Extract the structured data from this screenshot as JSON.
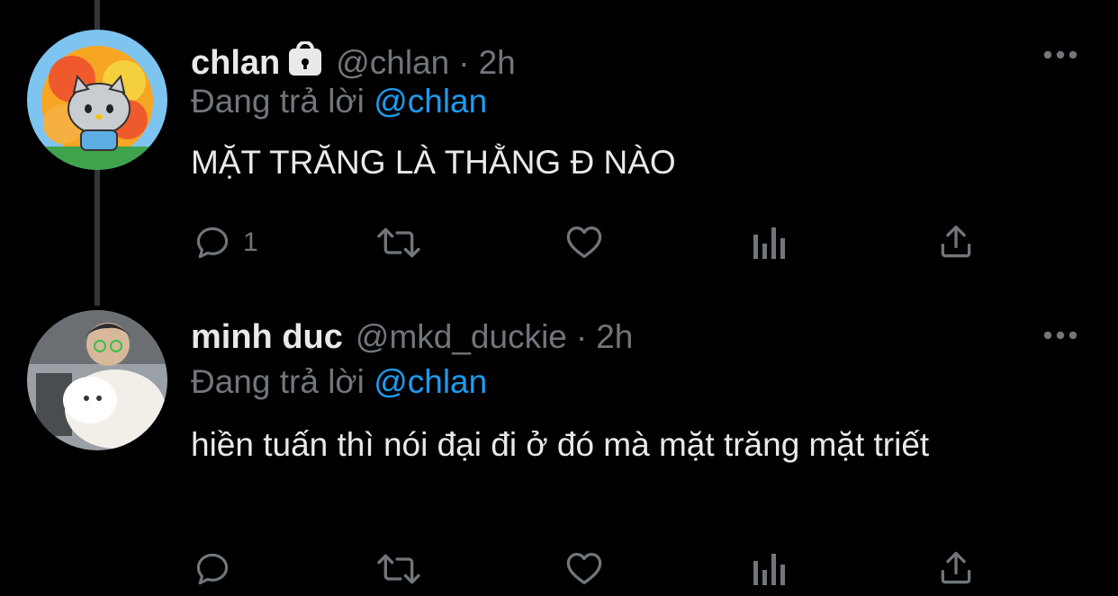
{
  "tweets": [
    {
      "display_name": "chlan",
      "protected": true,
      "handle": "@chlan",
      "separator": "·",
      "time": "2h",
      "reply_prefix": "Đang trả lời",
      "reply_to": "@chlan",
      "text": "MẶT TRĂNG LÀ THẰNG Đ NÀO",
      "reply_count": "1"
    },
    {
      "display_name": "minh duc",
      "protected": false,
      "handle": "@mkd_duckie",
      "separator": "·",
      "time": "2h",
      "reply_prefix": "Đang trả lời",
      "reply_to": "@chlan",
      "text": "hiền tuấn thì nói đại đi ở đó mà mặt trăng mặt triết",
      "reply_count": ""
    }
  ],
  "icons": {
    "protected": "lock-icon",
    "more": "more-horizontal-icon",
    "reply": "reply-icon",
    "retweet": "retweet-icon",
    "like": "heart-icon",
    "analytics": "analytics-icon",
    "share": "share-icon"
  },
  "colors": {
    "background": "#000000",
    "primary_text": "#e7e9ea",
    "secondary_text": "#71767b",
    "accent": "#1d9bf0",
    "thread_line": "#333639"
  }
}
